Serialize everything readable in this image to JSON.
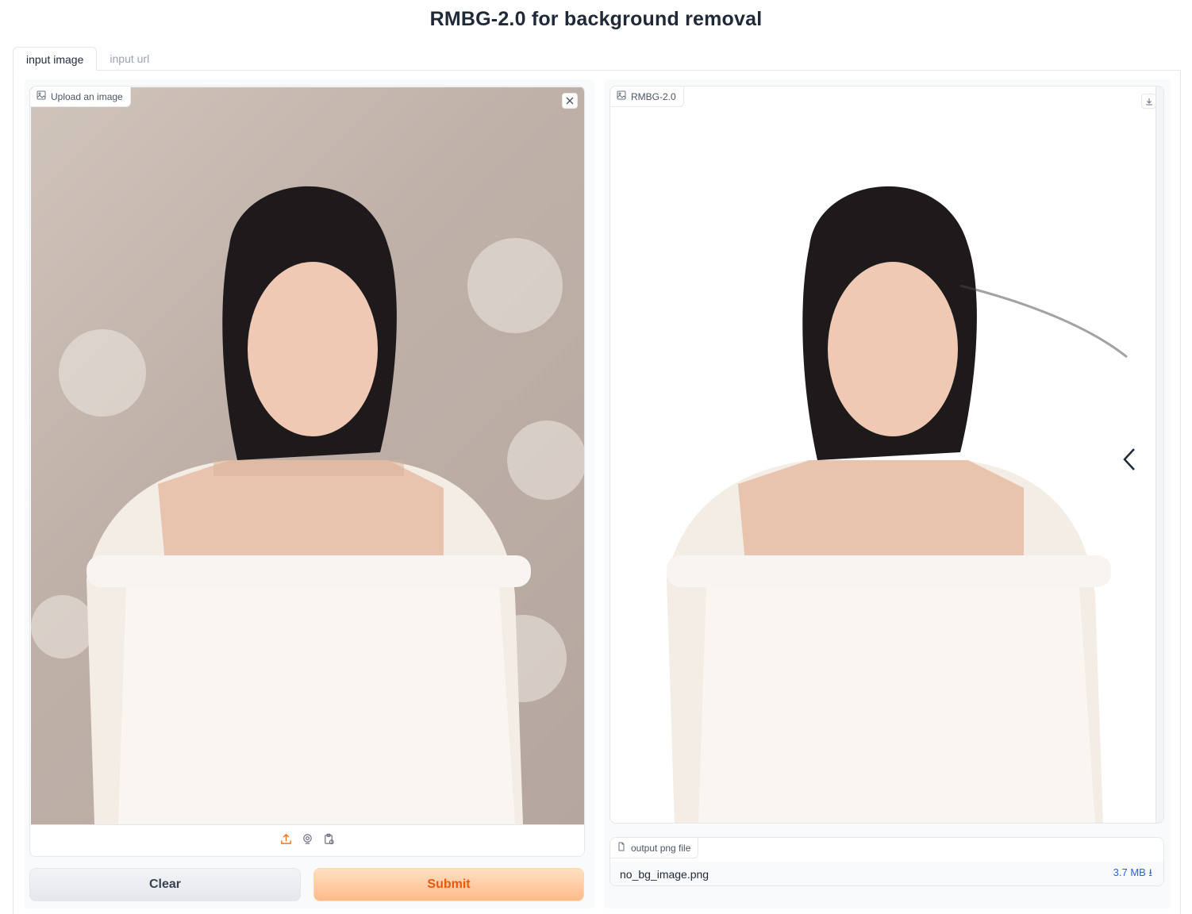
{
  "app": {
    "title": "RMBG-2.0 for background removal"
  },
  "tabs": [
    {
      "label": "input image",
      "active": true
    },
    {
      "label": "input url",
      "active": false
    }
  ],
  "input": {
    "label": "Upload an image",
    "clear_icon": "close-icon",
    "sources": [
      "upload-icon",
      "webcam-icon",
      "clipboard-icon"
    ]
  },
  "buttons": {
    "clear": "Clear",
    "submit": "Submit"
  },
  "output": {
    "label": "RMBG-2.0",
    "download_icon": "download-icon",
    "nav_icon": "chevron-left-icon"
  },
  "file": {
    "label": "output png file",
    "name": "no_bg_image.png",
    "size": "3.7 MB ⭳"
  },
  "colors": {
    "accent": "#f97316",
    "link": "#2563eb"
  }
}
